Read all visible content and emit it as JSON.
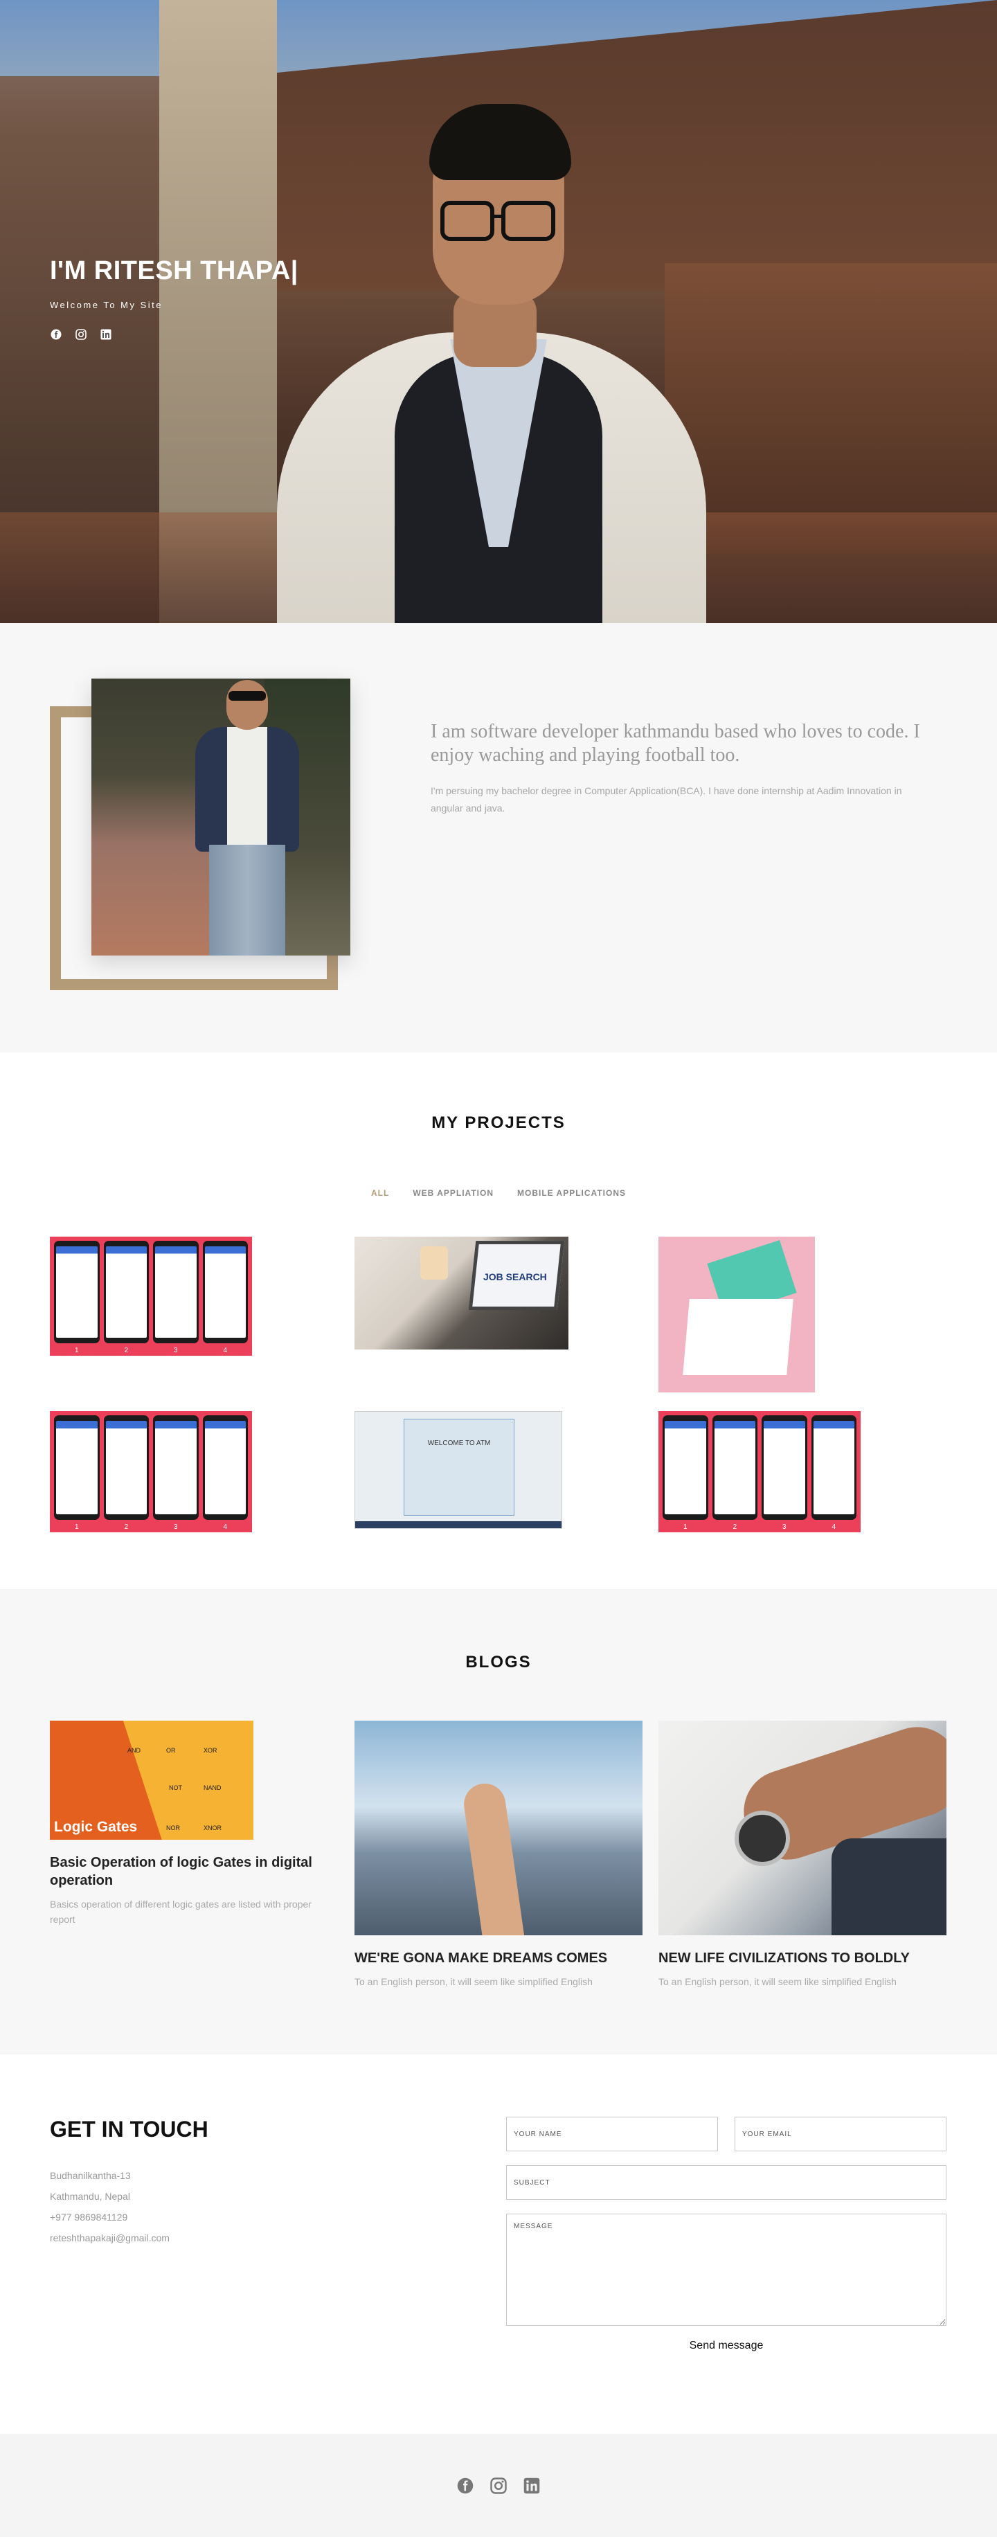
{
  "hero": {
    "title": "I'M RITESH THAPA|",
    "subtitle": "Welcome To My Site",
    "social": [
      "facebook-icon",
      "instagram-icon",
      "linkedin-icon"
    ]
  },
  "about": {
    "heading": "I am software developer kathmandu based who loves to code. I enjoy waching and playing football too.",
    "body": "I'm persuing my bachelor degree in Computer Application(BCA). I have done internship at Aadim Innovation in angular and java."
  },
  "projects": {
    "title": "MY PROJECTS",
    "filters": [
      "ALL",
      "WEB APPLIATION",
      "MOBILE APPLICATIONS"
    ],
    "thumbs": {
      "phone_numbers": [
        "1",
        "2",
        "3",
        "4"
      ],
      "job_search": "JOB SEARCH",
      "atm_title": "WELCOME TO ATM"
    }
  },
  "blogs": {
    "title": "BLOGS",
    "image_label": "Logic Gates",
    "gate_labels": [
      "AND",
      "OR",
      "XOR",
      "NOT",
      "NAND",
      "NOR",
      "XNOR"
    ],
    "posts": [
      {
        "title": "Basic Operation of logic Gates in digital operation",
        "desc": "Basics operation of different logic gates are listed with proper report"
      },
      {
        "title": "WE'RE GONA MAKE DREAMS COMES",
        "desc": "To an English person, it will seem like simplified English"
      },
      {
        "title": "NEW LIFE CIVILIZATIONS TO BOLDLY",
        "desc": "To an English person, it will seem like simplified English"
      }
    ]
  },
  "contact": {
    "title": "GET IN TOUCH",
    "address_line1": "Budhanilkantha-13",
    "address_line2": "Kathmandu, Nepal",
    "phone": "+977 9869841129",
    "email": "reteshthapakaji@gmail.com",
    "name_placeholder": "YOUR NAME",
    "email_placeholder": "YOUR EMAIL",
    "subject_placeholder": "SUBJECT",
    "message_placeholder": "MESSAGE",
    "send_label": "Send message"
  },
  "footer": {
    "social": [
      "facebook-icon",
      "instagram-icon",
      "linkedin-icon"
    ]
  },
  "colors": {
    "accent": "#b49b78",
    "project_bg": "#ec3f59",
    "section_gray": "#f7f7f7"
  }
}
